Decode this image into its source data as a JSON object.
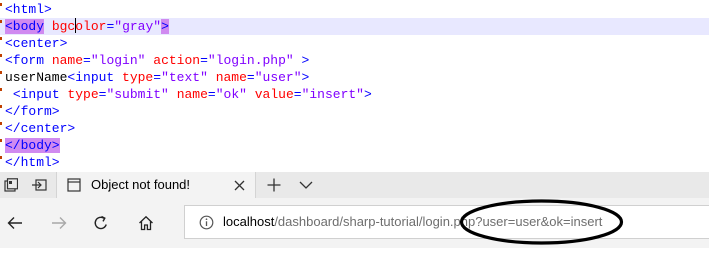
{
  "editor": {
    "lines": [
      {
        "parts": [
          {
            "c": "t",
            "s": "<html>"
          }
        ]
      },
      {
        "parts": [
          {
            "c": "t bm",
            "s": "<body"
          },
          {
            "c": "k",
            "s": " "
          },
          {
            "c": "a",
            "s": "bgc"
          },
          {
            "c": "caret",
            "s": ""
          },
          {
            "c": "a",
            "s": "olor"
          },
          {
            "c": "t",
            "s": "="
          },
          {
            "c": "v",
            "s": "\"gray\""
          },
          {
            "c": "t bm",
            "s": ">"
          }
        ]
      },
      {
        "parts": [
          {
            "c": "t",
            "s": "<center>"
          }
        ]
      },
      {
        "parts": [
          {
            "c": "t",
            "s": "<form "
          },
          {
            "c": "a",
            "s": "name"
          },
          {
            "c": "t",
            "s": "="
          },
          {
            "c": "v",
            "s": "\"login\""
          },
          {
            "c": "k",
            "s": " "
          },
          {
            "c": "a",
            "s": "action"
          },
          {
            "c": "t",
            "s": "="
          },
          {
            "c": "v",
            "s": "\"login.php\""
          },
          {
            "c": "k",
            "s": " "
          },
          {
            "c": "t",
            "s": ">"
          }
        ]
      },
      {
        "parts": [
          {
            "c": "k",
            "s": "userName"
          },
          {
            "c": "t",
            "s": "<input "
          },
          {
            "c": "a",
            "s": "type"
          },
          {
            "c": "t",
            "s": "="
          },
          {
            "c": "v",
            "s": "\"text\""
          },
          {
            "c": "k",
            "s": " "
          },
          {
            "c": "a",
            "s": "name"
          },
          {
            "c": "t",
            "s": "="
          },
          {
            "c": "v",
            "s": "\"user\""
          },
          {
            "c": "t",
            "s": ">"
          }
        ]
      },
      {
        "parts": [
          {
            "c": "k",
            "s": " "
          },
          {
            "c": "t",
            "s": "<input "
          },
          {
            "c": "a",
            "s": "type"
          },
          {
            "c": "t",
            "s": "="
          },
          {
            "c": "v",
            "s": "\"submit\""
          },
          {
            "c": "k",
            "s": " "
          },
          {
            "c": "a",
            "s": "name"
          },
          {
            "c": "t",
            "s": "="
          },
          {
            "c": "v",
            "s": "\"ok\""
          },
          {
            "c": "k",
            "s": " "
          },
          {
            "c": "a",
            "s": "value"
          },
          {
            "c": "t",
            "s": "="
          },
          {
            "c": "v",
            "s": "\"insert\""
          },
          {
            "c": "t",
            "s": ">"
          }
        ]
      },
      {
        "parts": [
          {
            "c": "t",
            "s": "</form>"
          }
        ]
      },
      {
        "parts": [
          {
            "c": "t",
            "s": "</center>"
          }
        ]
      },
      {
        "parts": [
          {
            "c": "t bm",
            "s": "</body>"
          }
        ]
      },
      {
        "parts": [
          {
            "c": "t",
            "s": "</html>"
          }
        ]
      }
    ],
    "highlighted_line": 1
  },
  "browser": {
    "tab_title": "Object not found!",
    "icons": {
      "tab_actions": "tab-actions-icon",
      "set_aside": "set-aside-tabs-icon",
      "page": "page-icon",
      "close": "close-icon",
      "new_tab": "plus-icon",
      "tab_menu": "chevron-down-icon",
      "back": "back-arrow-icon",
      "forward": "forward-arrow-icon",
      "refresh": "refresh-icon",
      "home": "home-icon",
      "site_info": "info-icon"
    },
    "url_host": "localhost",
    "url_rest": "/dashboard/sharp-tutorial/login.php?user=user&ok=insert"
  },
  "colors": {
    "tag": "#0000ff",
    "attribute": "#ff0000",
    "value": "#8000ff",
    "tag_match": "#d08af0",
    "line_highlight": "#e8e8ff"
  }
}
